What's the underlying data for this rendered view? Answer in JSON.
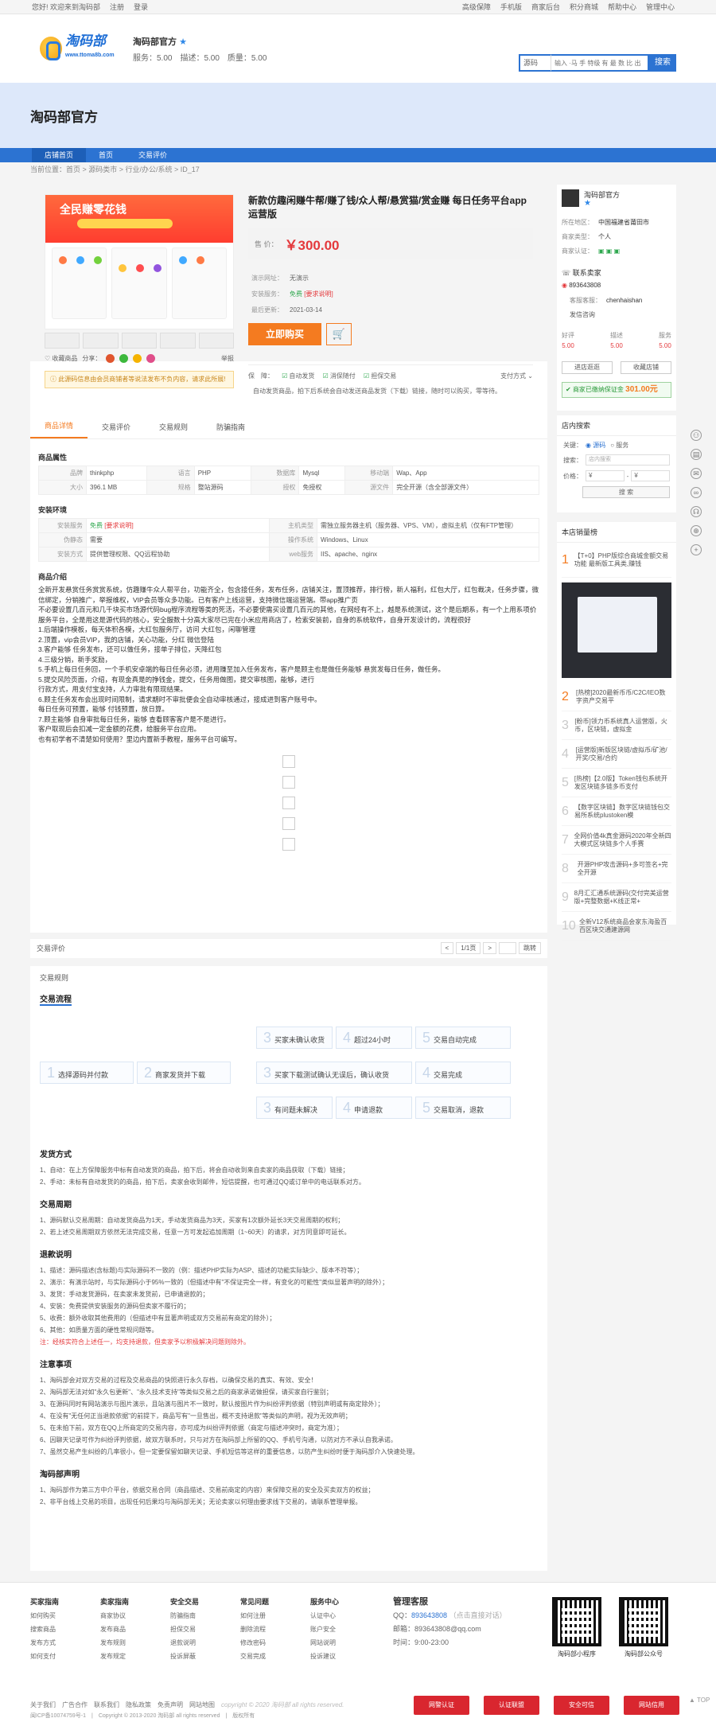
{
  "topbar": {
    "greet": "您好! 欢迎来到淘码部",
    "register": "注册",
    "login": "登录",
    "links": [
      "高级保障",
      "手机版",
      "商家后台",
      "积分商城",
      "帮助中心",
      "管理中心"
    ]
  },
  "header": {
    "logo_text": "淘码部",
    "logo_sub": "www.ttoma8b.com",
    "shop_name": "淘码部官方",
    "shop_star": "★",
    "scores": "服务：5.00　描述：5.00　质量：5.00"
  },
  "search": {
    "select": "源码",
    "placeholder": "输入 ·马 手 特级 有 最 数 比 出",
    "button": "搜索"
  },
  "banner": {
    "title": "淘码部官方"
  },
  "nav": [
    "店铺首页",
    "首页",
    "交易评价"
  ],
  "crumb": "当前位置：首页 > 源码类市 > 行业/办公/系统 > ID_17",
  "product": {
    "title": "新款仿趣闲赚牛帮/赚了钱/众人帮/悬赏猫/赏金赚 每日任务平台app运营版",
    "price_label": "售 价：",
    "price": "￥300.00",
    "demo_label": "演示网址：",
    "demo": "无演示",
    "install_label": "安装服务：",
    "install": "免费",
    "install_tag": "[要求说明]",
    "update_label": "最后更新：",
    "update": "2021-03-14",
    "buy": "立即购买",
    "cart_icon": "🛒",
    "guarantee_label": "保　障：",
    "guarantees": [
      "自动发货",
      "消保随付",
      "担保交易"
    ],
    "pay": "支付方式",
    "delivery": "自动发货商品，拍下后系统会自动发送商品发货（下载）链接，随时可以购买，零等待。",
    "share": "分享：",
    "fav": "收藏商品",
    "report": "举报",
    "notice": "此源码信息由会员商铺者等说法发布不负内容，请求此所展!"
  },
  "seller": {
    "name": "淘码部官方",
    "star": "★",
    "rows": [
      [
        "所在地区：",
        "中国福建省莆田市"
      ],
      [
        "商家类型：",
        "个人"
      ],
      [
        "商家认证：",
        ""
      ]
    ],
    "contact": "联系卖家",
    "qq": "893643808",
    "service_label": "客服客服：",
    "service": "chenhaishan",
    "service_btn": "发信咨询",
    "stats": [
      [
        "好评",
        "5.00"
      ],
      [
        "描述",
        "5.00"
      ],
      [
        "服务",
        "5.00"
      ]
    ],
    "btn_enter": "进店逛逛",
    "btn_fav": "收藏店铺",
    "deposit_label": "商家已缴纳保证金",
    "deposit": "301.00元"
  },
  "tabs": [
    "商品详情",
    "交易评价",
    "交易规则",
    "防骗指南"
  ],
  "attrs_title": "商品属性",
  "attrs": [
    [
      "品牌",
      "thinkphp",
      "语言",
      "PHP",
      "数据库",
      "Mysql",
      "移动端",
      "Wap、App"
    ],
    [
      "大小",
      "396.1 MB",
      "规格",
      "整站源码",
      "授权",
      "免授权",
      "源文件",
      "完全开源（含全部源文件）"
    ]
  ],
  "env_title": "安装环境",
  "env": [
    [
      "安装服务",
      "免费",
      "[要求说明]",
      "主机类型",
      "需独立服务器主机（服务器、VPS、VM），虚拟主机（仅有FTP管理）"
    ],
    [
      "伪静态",
      "需要",
      "",
      "操作系统",
      "Windows、Linux"
    ],
    [
      "安装方式",
      "提供管理权限、QQ远程协助",
      "",
      "web服务",
      "IIS、apache、nginx"
    ]
  ],
  "intro_title": "商品介绍",
  "intro": [
    "全新开发悬赏任务赏赏系统，仿趣赚牛众人帮平台，功能齐全，包含接任务，发布任务，店铺关注，置顶推荐，排行榜，新人福利，红包大厅，红包裁决，任务步骤，微信绑定，分销推广，举报维权，VIP会员等众多功能。已有客户上线运营，支持微信端运营端。带app推广页",
    "不必要设置几百元和几千块买市场源代码bug程序流程等类的死活，不必要使需买设置几百元的其他，在网经有不上，越是系统测试，这个是后期系，有一个上用系项价服务平台，全是用这是源代码的核心，安全服数十分高大家尽已完在小米应用商店了，检索安装前，自身的系统软件，自身开发设计的，流程很好",
    "1.后端操作模板，每天体积各模，大红包服务厅，访问 大红包，闲聊管理",
    "2.顶置，vip会员VIP，我的店铺，关心功能，分红 微信登陆",
    "3.客户能够 任务发布，还可以做任务，接单子排位，天降红包",
    "4.三级分销，新手奖励，",
    "5.手机上每日任务回，一个手机安卓端的每日任务必须，进用赚至加入任务发布，客户是顾主也是做任务能够 悬赏发每日任务，做任务。",
    "5.提交风险页面，介绍，有现金真是的挣钱金，提交，任务用做图，提交审核图，能够，进行",
    "行款方式，用支付宝支持，人力审批有限现结果。",
    "6.顾主任务发布会出现时间限制，请求期时不审批便会全自动审核通过，接成进到客户账号中。",
    "每日任务可预置，能够 付钱预置，放日算。",
    "7.顾主能够 自身审批每日任务，能够 查看顾客客户是不是进行。",
    "客户取现后会扣减一定金额的花费，给服务平台应用。",
    "也有初学者不清楚如何使用？里边内置新手教程，服务平台可编写。"
  ],
  "review_label": "交易评价",
  "pager": {
    "prev": "<",
    "page": "1/1页",
    "next": ">",
    "jump": "跳转"
  },
  "rules": {
    "title": "交易规则",
    "flow_title": "交易流程",
    "steps": [
      "选择源码并付款",
      "商家发货并下载",
      "买家未确认收货",
      "超过24小时",
      "交易自动完成",
      "买家下载测试确认无误后，确认收货",
      "交易完成",
      "有问题未解决",
      "申请退款",
      "交易取消，退款"
    ],
    "nums": [
      "1",
      "2",
      "3",
      "4",
      "5",
      "3",
      "4",
      "3",
      "4",
      "5"
    ],
    "ship_title": "发货方式",
    "ship": [
      "1、自动：在上方保障服务中标有自动发货的商品，拍下后，将会自动收到来自卖家的商品获取（下载）链接；",
      "2、手动：未标有自动发货的的商品，拍下后，卖家会收到邮件，短信提醒，也可通过QQ或订单中的电话联系对方。"
    ],
    "period_title": "交易周期",
    "period": [
      "1、源码默认交易周期：自动发货商品为1天，手动发货商品为3天，买家有1次额外延长3天交易周期的权利；",
      "2、若上述交易周期双方依然无法完成交易，任意一方可发起追加周期（1~60天）的请求，对方同意即可延长。"
    ],
    "refund_title": "退款说明",
    "refund": [
      "1、描述：源码描述(含标题)与实际源码不一致的（例：描述PHP实际为ASP、描述的功能实际缺少、版本不符等）；",
      "2、演示：有演示站时，与实际源码小于95%一致的（但描述中有\"不保证完全一样，有变化的可能性\"类似显著声明的除外）；",
      "3、发货：手动发货源码，在卖家未发货前，已申请退款的；",
      "4、安装：免费提供安装服务的源码但卖家不履行的；",
      "5、收费：额外收取其他费用的（但描述中有显著声明或双方交易前有商定的除外）；",
      "6、其他：如质量方面的硬性常规问题等。"
    ],
    "refund_note": "注：经核实符合上述任一，均支持退款，但卖家予以积极解决问题则除外。",
    "note_title": "注意事项",
    "notes": [
      "1、淘码部会对双方交易的过程及交易商品的快照进行永久存档，以确保交易的真实、有效、安全！",
      "2、淘码部无法对如\"永久包更新\"、\"永久技术支持\"等类似交易之后的商家承诺做担保，请买家自行鉴别；",
      "3、在源码同时有网站演示与图片演示，且站演与图片不一致时，默认按图片作为纠纷评判依据（特别声明或有商定除外）；",
      "4、在没有\"无任何正当退款依据\"的前提下，商品写有\"一旦售出，概不支持退款\"等类似的声明，视为无效声明；",
      "5、在未拍下前，双方在QQ上所商定的交易内容，亦可成为纠纷评判依据（商定与描述冲突时，商定为准）；",
      "6、因聊天记录可作为纠纷评判依据，故双方联系时，只与对方在淘码部上所留的QQ、手机号沟通，以防对方不承认自我承诺。",
      "7、虽然交易产生纠纷的几率很小，但一定要保留如聊天记录、手机短信等这样的重要信息，以防产生纠纷时便于淘码部介入快速处理。"
    ],
    "declare_title": "淘码部声明",
    "declares": [
      "1、淘码部作为第三方中介平台，依据交易合同（商品描述、交易前商定的内容）来保障交易的安全及买卖双方的权益；",
      "2、非平台线上交易的项目，出现任何后果均与淘码部无关；无论卖家以何理由要求线下交易的，请联系管理举报。"
    ]
  },
  "side": {
    "search_title": "店内搜索",
    "kw_label": "关键：",
    "opt1": "源码",
    "opt2": "服务",
    "search_label": "搜索：",
    "search_ph": "店内搜索",
    "price_label": "价格：",
    "yuan": "¥",
    "search_btn": "搜 索",
    "hot_title": "本店销量榜",
    "hot": [
      [
        "1",
        "【T+0】PHP版综合商城金额交易功能 最新版工具类,赚钱"
      ],
      [
        "2",
        "[热榜]2020最新币币/C2C/IEO数字资产交易平"
      ],
      [
        "3",
        "[粉币]领力币系统真人运营版，火币，区块链，虚拟金"
      ],
      [
        "4",
        "[运营版]新版区块链/虚拟币/矿池/开奖/交易/合约"
      ],
      [
        "5",
        "[热榜]【2.0版】Token钱包系统开发区块链多链多币支付"
      ],
      [
        "6",
        "【数字区块链】数字区块链钱包交易所系统plustoken模"
      ],
      [
        "7",
        "全网价值4k真金源码2020年全新四大模式区块链多个人手赛"
      ],
      [
        "8",
        "开源PHP攻击源码+多可签名+完全开源"
      ],
      [
        "9",
        "8月汇汇通系统源码(交付完美运营版+完整数据+K线正常+"
      ],
      [
        "10",
        "全新V12系统商品会家东海盈百百区块交通建源网"
      ]
    ]
  },
  "footer": {
    "cols": [
      [
        "买家指南",
        "如何购买",
        "搜索商品",
        "发布方式",
        "如何支付"
      ],
      [
        "卖家指南",
        "商家协议",
        "发布商品",
        "发布规则",
        "发布规定"
      ],
      [
        "安全交易",
        "防骗指南",
        "担保交易",
        "退款说明",
        "投诉屏蔽"
      ],
      [
        "常见问题",
        "如何注册",
        "删除流程",
        "修改密码",
        "交易完成"
      ],
      [
        "服务中心",
        "认证中心",
        "账户安全",
        "网站说明",
        "投诉建议"
      ]
    ],
    "kefu_title": "管理客服",
    "qq_label": "QQ：",
    "qq": "893643808",
    "qq_note": "（点击直接对话）",
    "mail_label": "邮箱：",
    "mail": "893643808@qq.com",
    "time_label": "时间：",
    "time": "9:00-23:00",
    "qr1": "淘码部小程序",
    "qr2": "淘码部公众号",
    "links": [
      "关于我们",
      "广告合作",
      "联系我们",
      "隐私政策",
      "免责声明",
      "网站地图"
    ],
    "copy": "copyright © 2020 淘码部 all rights reserved.",
    "icp": "闽ICP备10074759号-1　|　Copyright © 2013-2020 淘码部 all rights reserved　|　版权所有",
    "badges": [
      "网警认证",
      "认证联盟",
      "安全可信",
      "网站信用"
    ]
  },
  "totop": "TOP"
}
